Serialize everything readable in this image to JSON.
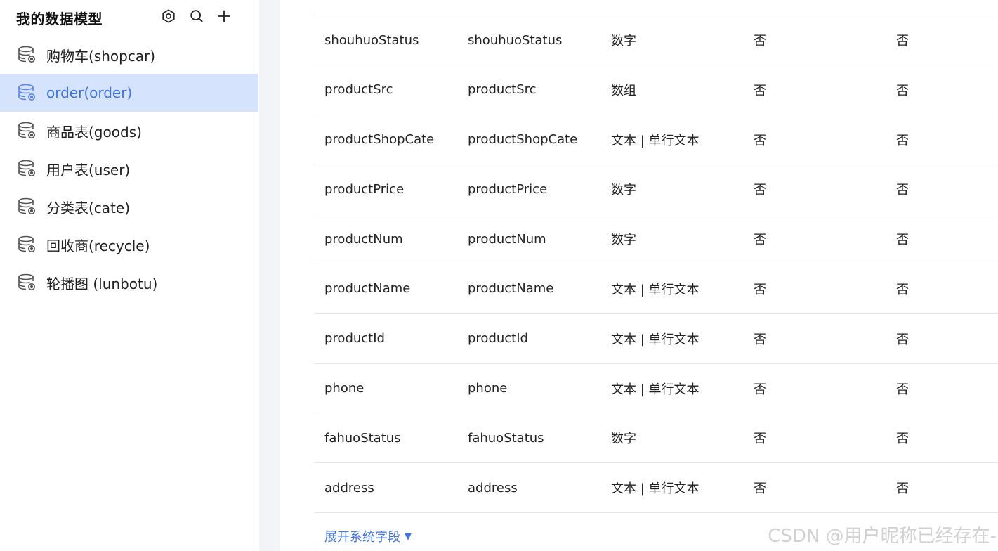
{
  "sidebar": {
    "title": "我的数据模型",
    "header_icons": [
      "settings-hex-icon",
      "search-icon",
      "plus-icon"
    ],
    "items": [
      {
        "label": "购物车(shopcar)",
        "active": false
      },
      {
        "label": "order(order)",
        "active": true
      },
      {
        "label": "商品表(goods)",
        "active": false
      },
      {
        "label": "用户表(user)",
        "active": false
      },
      {
        "label": "分类表(cate)",
        "active": false
      },
      {
        "label": "回收商(recycle)",
        "active": false
      },
      {
        "label": "轮播图 (lunbotu)",
        "active": false
      }
    ]
  },
  "fields": {
    "rows": [
      [
        "shouhuoStatus",
        "shouhuoStatus",
        "数字",
        "否",
        "否"
      ],
      [
        "productSrc",
        "productSrc",
        "数组",
        "否",
        "否"
      ],
      [
        "productShopCate",
        "productShopCate",
        "文本 | 单行文本",
        "否",
        "否"
      ],
      [
        "productPrice",
        "productPrice",
        "数字",
        "否",
        "否"
      ],
      [
        "productNum",
        "productNum",
        "数字",
        "否",
        "否"
      ],
      [
        "productName",
        "productName",
        "文本 | 单行文本",
        "否",
        "否"
      ],
      [
        "productId",
        "productId",
        "文本 | 单行文本",
        "否",
        "否"
      ],
      [
        "phone",
        "phone",
        "文本 | 单行文本",
        "否",
        "否"
      ],
      [
        "fahuoStatus",
        "fahuoStatus",
        "数字",
        "否",
        "否"
      ],
      [
        "address",
        "address",
        "文本 | 单行文本",
        "否",
        "否"
      ]
    ],
    "expand_label": "展开系统字段",
    "expand_caret": "▼"
  },
  "watermark": "CSDN @用户昵称已经存在-",
  "colors": {
    "accent": "#3f73ea",
    "active_bg": "#d5e3fd",
    "gutter_bg": "#f3f4f8",
    "divider": "#e7e8ec"
  }
}
